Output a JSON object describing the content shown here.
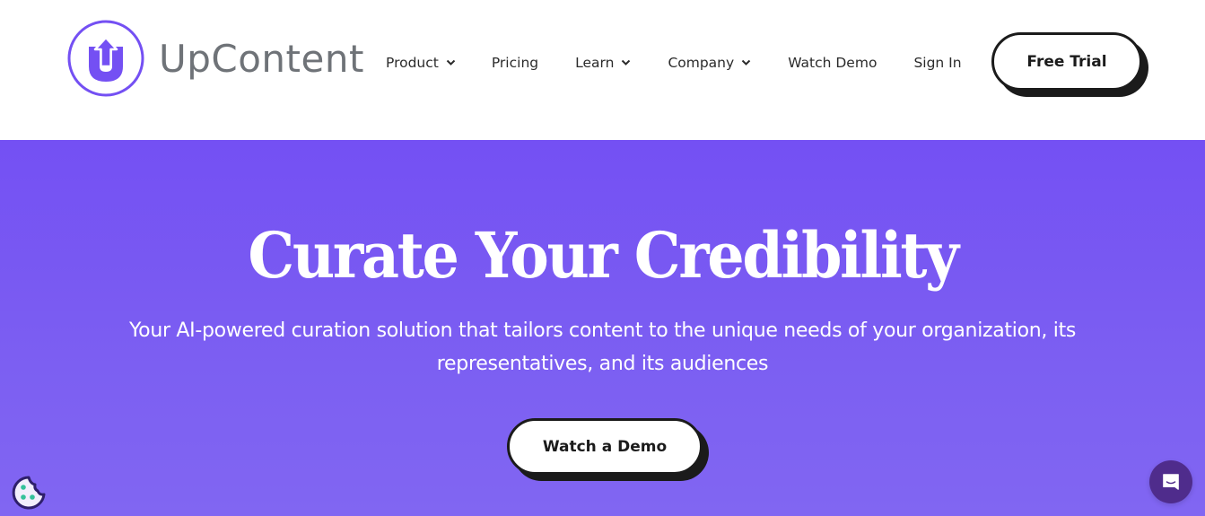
{
  "brand": {
    "name": "UpContent",
    "accent_color": "#7450f3",
    "logo_icon": "u-arrow-up-logo-icon"
  },
  "nav": {
    "items": [
      {
        "label": "Product",
        "has_dropdown": true
      },
      {
        "label": "Pricing",
        "has_dropdown": false
      },
      {
        "label": "Learn",
        "has_dropdown": true
      },
      {
        "label": "Company",
        "has_dropdown": true
      },
      {
        "label": "Watch Demo",
        "has_dropdown": false
      },
      {
        "label": "Sign In",
        "has_dropdown": false
      }
    ],
    "cta_label": "Free Trial"
  },
  "hero": {
    "title": "Curate Your Credibility",
    "subtitle": "Your AI-powered curation solution that tailors content to the unique needs of your organization, its representatives, and its audiences",
    "cta_label": "Watch a Demo",
    "background_color": "#7450f3"
  },
  "widgets": {
    "cookie_icon": "cookie-icon",
    "chat_icon": "chat-bubble-icon",
    "chat_color": "#4f2c8c"
  }
}
